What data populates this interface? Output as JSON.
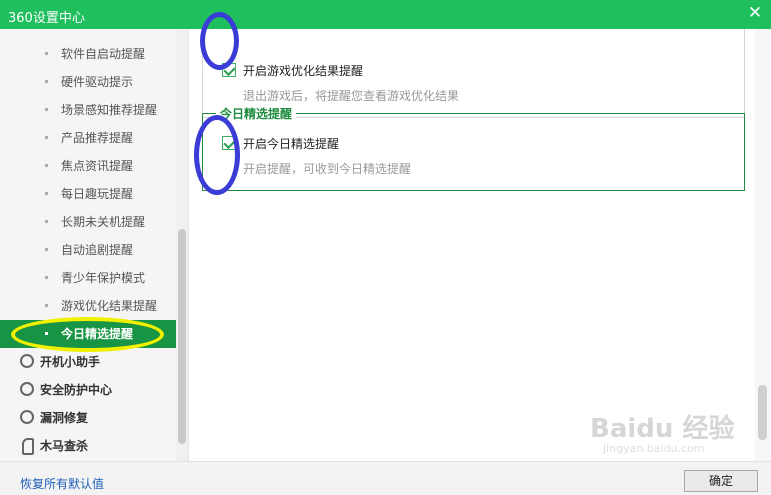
{
  "window": {
    "title": "360设置中心",
    "close_glyph": "✕"
  },
  "sidebar": {
    "sub_items": [
      {
        "label": "软件自启动提醒",
        "active": false
      },
      {
        "label": "硬件驱动提示",
        "active": false
      },
      {
        "label": "场景感知推荐提醒",
        "active": false
      },
      {
        "label": "产品推荐提醒",
        "active": false
      },
      {
        "label": "焦点资讯提醒",
        "active": false
      },
      {
        "label": "每日趣玩提醒",
        "active": false
      },
      {
        "label": "长期未关机提醒",
        "active": false
      },
      {
        "label": "自动追剧提醒",
        "active": false
      },
      {
        "label": "青少年保护模式",
        "active": false
      },
      {
        "label": "游戏优化结果提醒",
        "active": false
      },
      {
        "label": "今日精选提醒",
        "active": true
      }
    ],
    "categories": [
      {
        "label": "开机小助手",
        "icon": "clock-icon"
      },
      {
        "label": "安全防护中心",
        "icon": "shield-icon"
      },
      {
        "label": "漏洞修复",
        "icon": "patch-icon"
      },
      {
        "label": "木马查杀",
        "icon": "horse-icon"
      }
    ]
  },
  "content": {
    "game_result": {
      "checkbox_label": "开启游戏优化结果提醒",
      "checked": true,
      "description": "退出游戏后，将提醒您查看游戏优化结果"
    },
    "daily_pick": {
      "group_title": "今日精选提醒",
      "checkbox_label": "开启今日精选提醒",
      "checked": true,
      "description": "开启提醒，可收到今日精选提醒"
    }
  },
  "watermark": {
    "text": "Baidu 经验",
    "url": "jingyan.baidu.com"
  },
  "footer": {
    "restore_defaults": "恢复所有默认值",
    "ok_label": "确定"
  },
  "colors": {
    "titlebar": "#1ebf5c",
    "active_item": "#189544",
    "group_border": "#1f8c3f",
    "link": "#1d5fb8",
    "annotation_yellow": "#f0f000",
    "annotation_blue": "#3b3bd6"
  }
}
